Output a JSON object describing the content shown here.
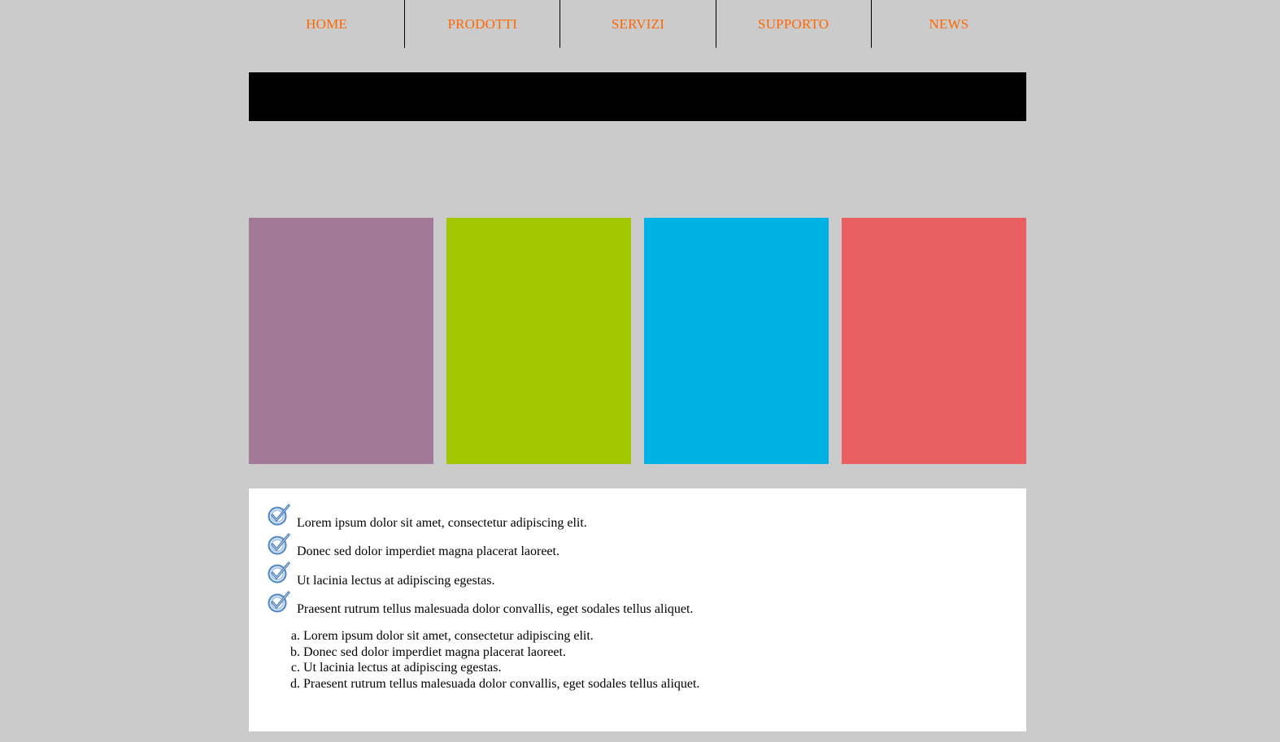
{
  "nav": {
    "items": [
      {
        "label": "HOME"
      },
      {
        "label": "PRODOTTI"
      },
      {
        "label": "SERVIZI"
      },
      {
        "label": "SUPPORTO"
      },
      {
        "label": "NEWS"
      }
    ],
    "color": "#ff6600"
  },
  "colors": {
    "background": "#cbcbcb",
    "banner": "#000000",
    "box1": "#a27997",
    "box2": "#a2c700",
    "box3": "#00b2e4",
    "box4": "#ea5f61",
    "content_bg": "#ffffff"
  },
  "checklist": {
    "icon": "checkmark-badge-icon",
    "items": [
      {
        "text": "Lorem ipsum dolor sit amet, consectetur adipiscing elit."
      },
      {
        "text": "Donec sed dolor imperdiet magna placerat laoreet."
      },
      {
        "text": "Ut lacinia lectus at adipiscing egestas."
      },
      {
        "text": "Praesent rutrum tellus malesuada dolor convallis, eget sodales tellus aliquet."
      }
    ]
  },
  "ordered_list": {
    "items": [
      {
        "marker": "a.",
        "text": "Lorem ipsum dolor sit amet, consectetur adipiscing elit."
      },
      {
        "marker": "b.",
        "text": "Donec sed dolor imperdiet magna placerat laoreet."
      },
      {
        "marker": "c.",
        "text": "Ut lacinia lectus at adipiscing egestas."
      },
      {
        "marker": "d.",
        "text": "Praesent rutrum tellus malesuada dolor convallis, eget sodales tellus aliquet."
      }
    ]
  }
}
